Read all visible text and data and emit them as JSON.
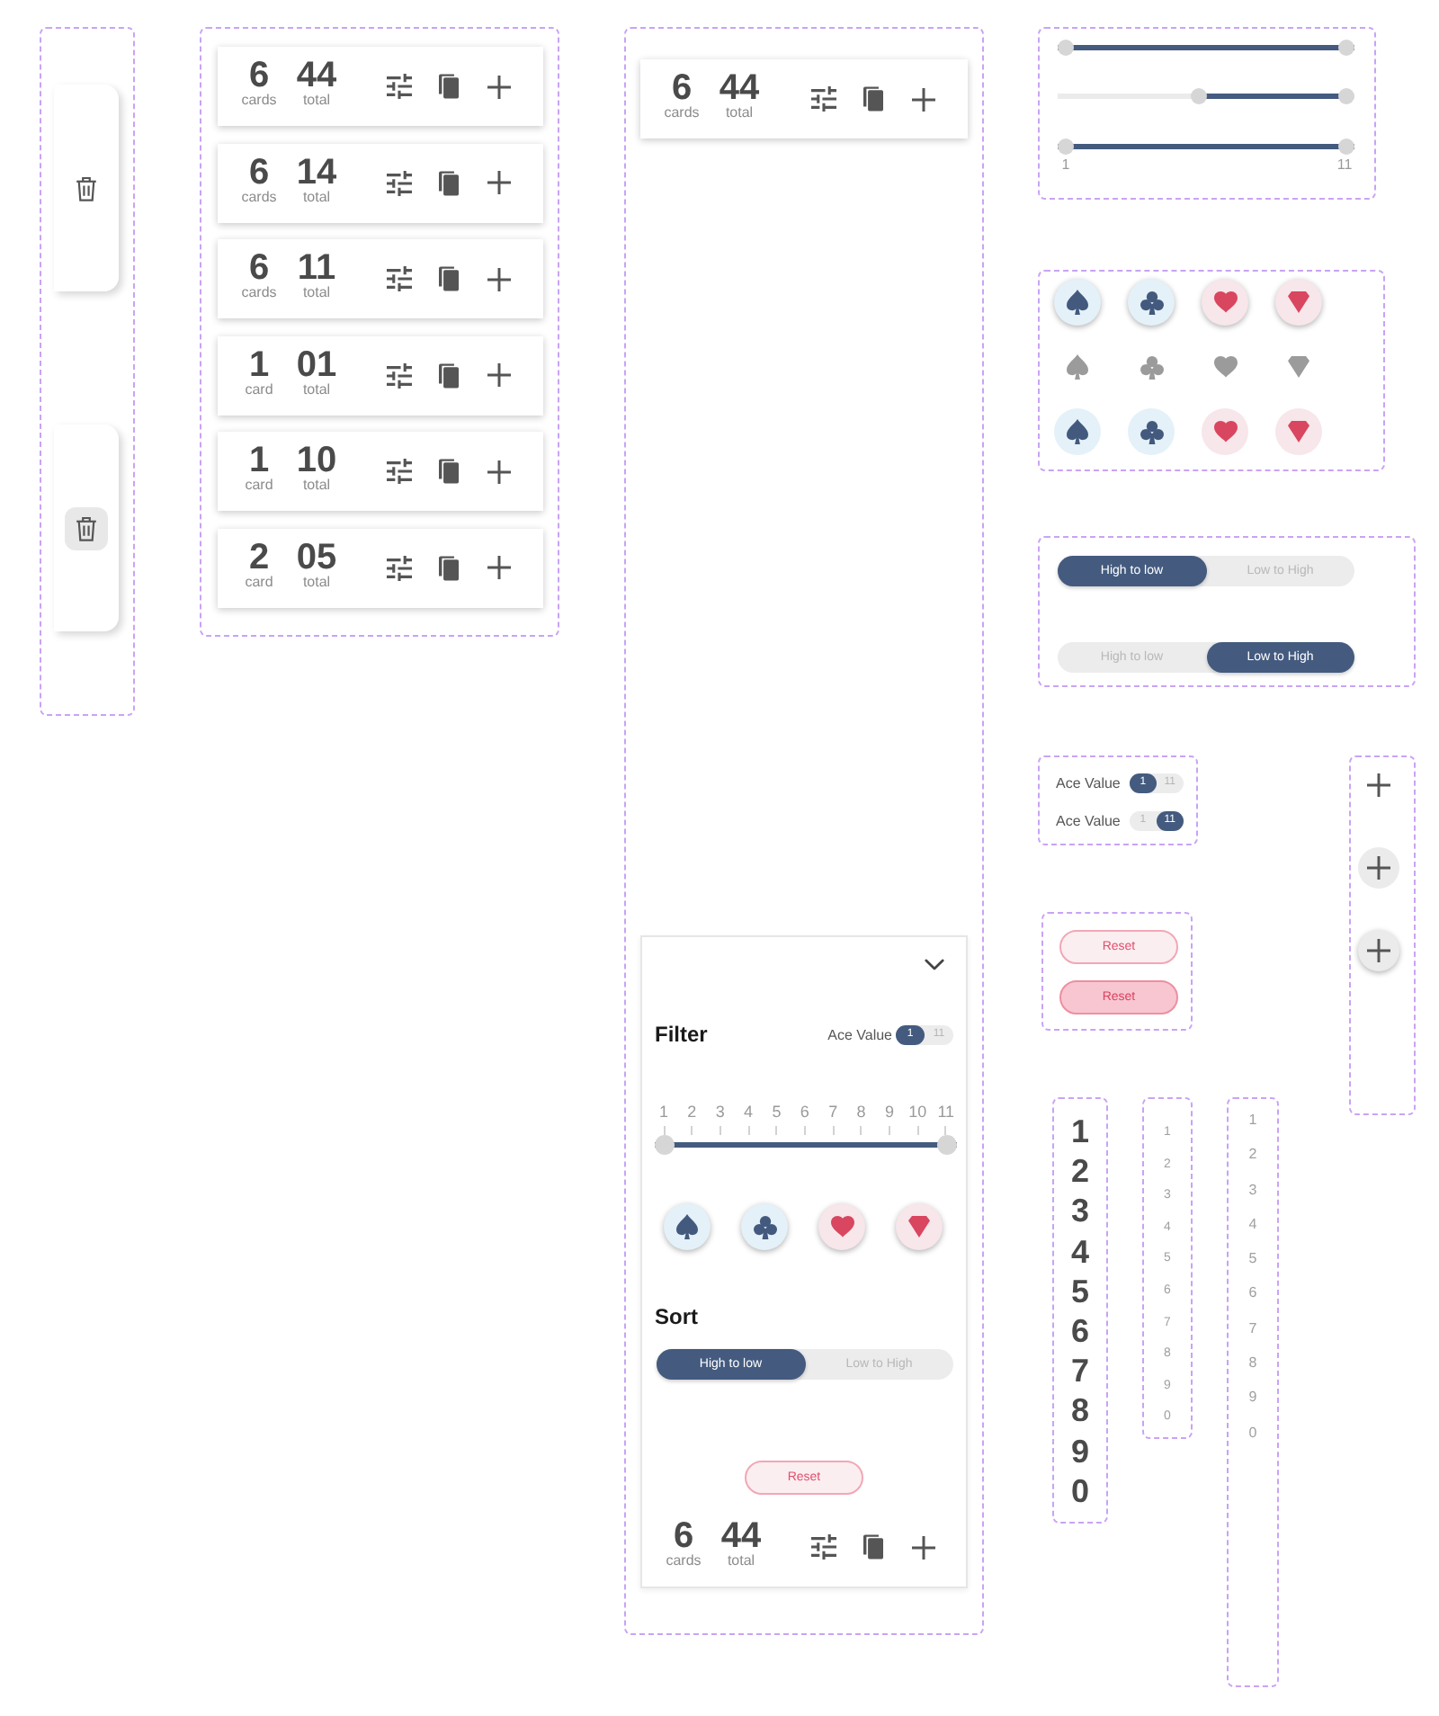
{
  "drawer_tabs": [
    {
      "hovered": false
    },
    {
      "hovered": true
    }
  ],
  "hand_summaries": [
    {
      "count": "6",
      "count_label": "cards",
      "total": "44",
      "total_label": "total"
    },
    {
      "count": "6",
      "count_label": "cards",
      "total": "14",
      "total_label": "total"
    },
    {
      "count": "6",
      "count_label": "cards",
      "total": "11",
      "total_label": "total"
    },
    {
      "count": "1",
      "count_label": "card",
      "total": "01",
      "total_label": "total"
    },
    {
      "count": "1",
      "count_label": "card",
      "total": "10",
      "total_label": "total"
    },
    {
      "count": "2",
      "count_label": "card",
      "total": "05",
      "total_label": "total"
    }
  ],
  "filter_demo": {
    "collapsed_bar": {
      "count": "6",
      "count_label": "cards",
      "total": "44",
      "total_label": "total"
    },
    "panel": {
      "title": "Filter",
      "ace_toggle": {
        "label": "Ace Value",
        "options": [
          {
            "label": "1",
            "selected": true
          },
          {
            "label": "11",
            "selected": false
          }
        ]
      },
      "range_slider": {
        "tick_labels": [
          "1",
          "2",
          "3",
          "4",
          "5",
          "6",
          "7",
          "8",
          "9",
          "10",
          "11"
        ],
        "level": 1
      },
      "suit_row": {
        "disabled": false,
        "elevated": true,
        "buttons": [
          {
            "kind": "spade"
          },
          {
            "kind": "club"
          },
          {
            "kind": "heart"
          },
          {
            "kind": "diamond"
          }
        ]
      },
      "sort_title": "Sort",
      "sort_toggle": {
        "options": [
          {
            "label": "High to low",
            "selected": true
          },
          {
            "label": "Low to High",
            "selected": false
          }
        ]
      },
      "reset": {
        "label": "Reset",
        "pressed": false
      },
      "summary": {
        "count": "6",
        "count_label": "cards",
        "total": "44",
        "total_label": "total"
      }
    }
  },
  "range_sliders": [
    {
      "level": 1
    },
    {
      "level": 0.52,
      "reversed": true
    },
    {
      "level": 1,
      "end_labels": [
        "1",
        "11"
      ]
    }
  ],
  "suit_rows": [
    {
      "disabled": false,
      "elevated": true,
      "buttons": [
        {
          "kind": "spade"
        },
        {
          "kind": "club"
        },
        {
          "kind": "heart"
        },
        {
          "kind": "diamond"
        }
      ]
    },
    {
      "disabled": true,
      "elevated": false,
      "buttons": [
        {
          "kind": "spade"
        },
        {
          "kind": "club"
        },
        {
          "kind": "heart"
        },
        {
          "kind": "diamond"
        }
      ]
    },
    {
      "disabled": false,
      "elevated": false,
      "buttons": [
        {
          "kind": "spade"
        },
        {
          "kind": "club"
        },
        {
          "kind": "heart"
        },
        {
          "kind": "diamond"
        }
      ]
    }
  ],
  "sort_toggles": [
    {
      "options": [
        {
          "label": "High to low",
          "selected": true
        },
        {
          "label": "Low to High",
          "selected": false
        }
      ]
    },
    {
      "options": [
        {
          "label": "High to low",
          "selected": false
        },
        {
          "label": "Low to High",
          "selected": true
        }
      ]
    }
  ],
  "ace_toggles": [
    {
      "label": "Ace Value",
      "options": [
        {
          "label": "1",
          "selected": true
        },
        {
          "label": "11",
          "selected": false
        }
      ]
    },
    {
      "label": "Ace Value",
      "options": [
        {
          "label": "1",
          "selected": false
        },
        {
          "label": "11",
          "selected": true
        }
      ]
    }
  ],
  "reset_buttons": [
    {
      "label": "Reset",
      "pressed": false
    },
    {
      "label": "Reset",
      "pressed": true
    }
  ],
  "add_buttons": [
    {
      "filled": false,
      "elevated": false
    },
    {
      "filled": true,
      "elevated": false
    },
    {
      "filled": true,
      "elevated": true
    }
  ],
  "digit_columns": [
    {
      "kind": "bold",
      "digits": [
        "1",
        "2",
        "3",
        "4",
        "5",
        "6",
        "7",
        "8",
        "9",
        "0"
      ]
    },
    {
      "kind": "small",
      "digits": [
        "1",
        "2",
        "3",
        "4",
        "5",
        "6",
        "7",
        "8",
        "9",
        "0"
      ]
    },
    {
      "kind": "regular",
      "digits": [
        "1",
        "2",
        "3",
        "4",
        "5",
        "6",
        "7",
        "8",
        "9",
        "0"
      ]
    }
  ]
}
